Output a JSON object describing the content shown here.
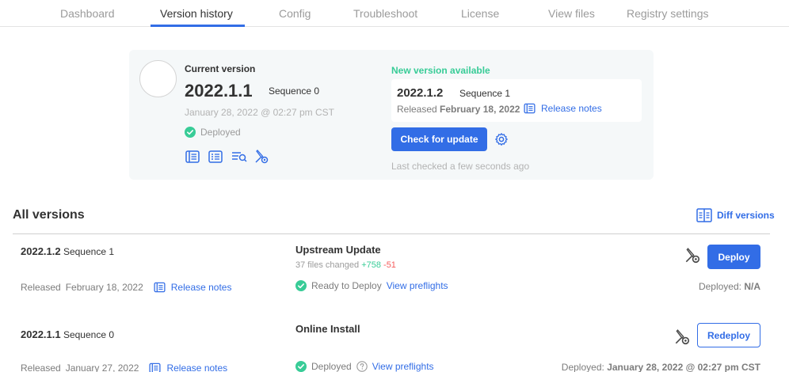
{
  "nav": {
    "tabs": [
      {
        "label": "Dashboard",
        "active": false
      },
      {
        "label": "Version history",
        "active": true
      },
      {
        "label": "Config",
        "active": false
      },
      {
        "label": "Troubleshoot",
        "active": false
      },
      {
        "label": "License",
        "active": false
      },
      {
        "label": "View files",
        "active": false
      },
      {
        "label": "Registry settings",
        "active": false
      }
    ]
  },
  "current": {
    "label": "Current version",
    "version": "2022.1.1",
    "sequence": "Sequence 0",
    "date": "January 28, 2022 @ 02:27 pm CST",
    "status": "Deployed",
    "icons": [
      "release-notes-icon",
      "checklist-icon",
      "logs-icon",
      "edit-config-icon"
    ]
  },
  "new_version": {
    "label": "New version available",
    "version": "2022.1.2",
    "sequence": "Sequence 1",
    "released_prefix": "Released",
    "released_date": "February 18, 2022",
    "release_notes": "Release notes",
    "check_button": "Check for update",
    "last_checked": "Last checked a few seconds ago"
  },
  "all_versions": {
    "title": "All versions",
    "diff_label": "Diff versions",
    "rows": [
      {
        "version": "2022.1.2",
        "sequence": "Sequence 1",
        "released_prefix": "Released",
        "released_date": "February 18, 2022",
        "release_notes": "Release notes",
        "title": "Upstream Update",
        "files_changed": "37 files changed",
        "additions": "+758",
        "deletions": "-51",
        "status": "Ready to Deploy",
        "preflights": "View preflights",
        "action": "Deploy",
        "deployed_label": "Deployed:",
        "deployed_value": "N/A"
      },
      {
        "version": "2022.1.1",
        "sequence": "Sequence 0",
        "released_prefix": "Released",
        "released_date": "January 27, 2022",
        "release_notes": "Release notes",
        "title": "Online Install",
        "status": "Deployed",
        "preflights": "View preflights",
        "action": "Redeploy",
        "deployed_label": "Deployed:",
        "deployed_value": "January 28, 2022 @ 02:27 pm CST"
      }
    ]
  },
  "colors": {
    "accent": "#326de6",
    "success": "#38cc97",
    "danger": "#f65c5c",
    "card_bg": "#f5f8f9"
  }
}
